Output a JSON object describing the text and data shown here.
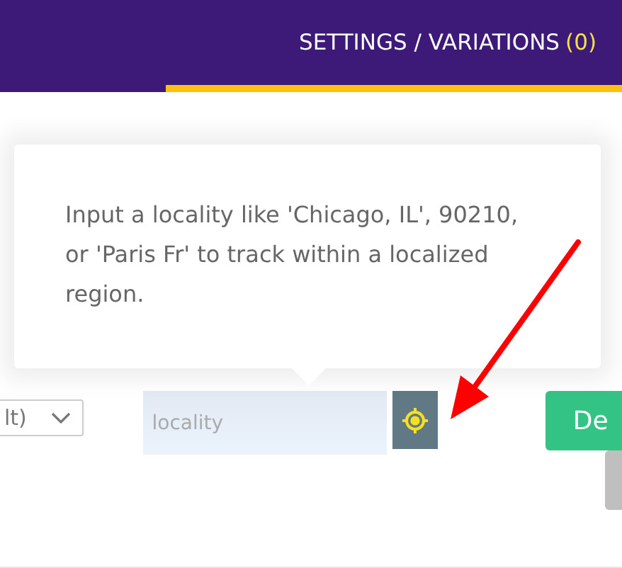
{
  "tabs": [
    {
      "label": "SETTINGS / VARIATIONS",
      "count": "(0)",
      "selected": true
    }
  ],
  "tooltip": {
    "text": "Input a locality like 'Chicago, IL', 90210, or 'Paris Fr' to track within a localized region."
  },
  "select": {
    "value": "lt)"
  },
  "locality_field": {
    "placeholder": "locality"
  },
  "action_button": {
    "label": "De"
  }
}
